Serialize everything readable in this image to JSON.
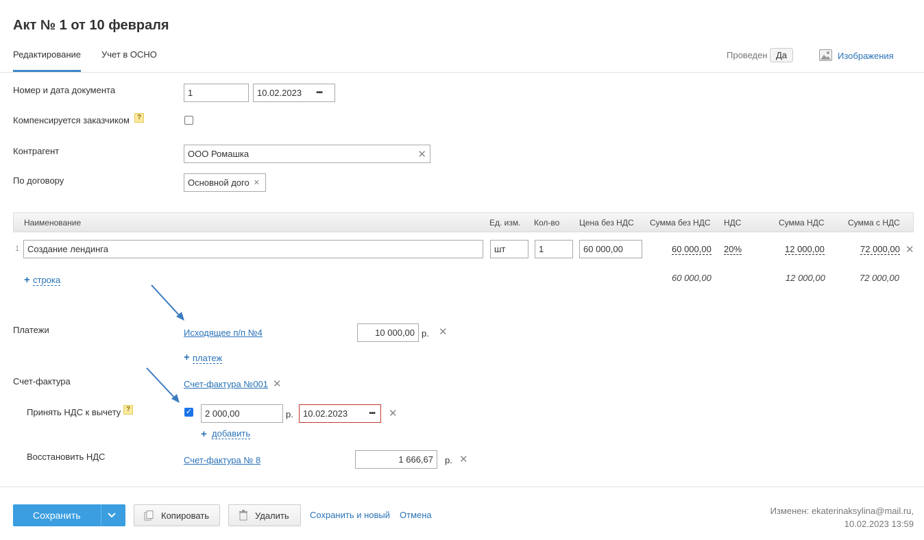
{
  "title": "Акт № 1 от 10 февраля",
  "tabs": [
    {
      "label": "Редактирование",
      "active": true
    },
    {
      "label": "Учет в ОСНО",
      "active": false
    }
  ],
  "header": {
    "posted_label": "Проведен",
    "posted_value": "Да",
    "images_label": "Изображения"
  },
  "form": {
    "doc_label": "Номер и дата документа",
    "doc_number": "1",
    "doc_date": "10.02.2023",
    "compensated_label": "Компенсируется заказчиком",
    "help_glyph": "?",
    "counterparty_label": "Контрагент",
    "counterparty_value": "ООО Ромашка",
    "contract_label": "По договору",
    "contract_value": "Основной дого"
  },
  "table": {
    "headers": [
      "Наименование",
      "Ед. изм.",
      "Кол-во",
      "Цена без НДС",
      "Сумма без НДС",
      "НДС",
      "Сумма НДС",
      "Сумма с НДС"
    ],
    "rows": [
      {
        "index": "1",
        "name": "Создание лендинга",
        "unit": "шт",
        "qty": "1",
        "price": "60 000,00",
        "sum_no_vat": "60 000,00",
        "vat": "20%",
        "vat_sum": "12 000,00",
        "total": "72 000,00"
      }
    ],
    "add_row": "строка",
    "totals": {
      "sum_no_vat": "60 000,00",
      "vat_sum": "12 000,00",
      "total": "72 000,00"
    }
  },
  "payments": {
    "label": "Платежи",
    "doc_link": "Исходящее п/п №4",
    "amount": "10 000,00",
    "currency": "р.",
    "add_label": "платеж"
  },
  "invoice": {
    "label": "Счет-фактура",
    "link": "Счет-фактура №001",
    "accept_vat_label": "Принять НДС к вычету",
    "accept_amount": "2 000,00",
    "currency": "р.",
    "accept_date": "10.02.2023",
    "add_label": "добавить",
    "restore_vat_label": "Восстановить НДС",
    "restore_link": "Счет-фактура № 8",
    "restore_amount": "1 666,67"
  },
  "footer": {
    "save": "Сохранить",
    "copy": "Копировать",
    "delete": "Удалить",
    "save_new": "Сохранить и новый",
    "cancel": "Отмена",
    "modified_line1": "Изменен: ekaterinaksylina@mail.ru,",
    "modified_line2": "10.02.2023 13:59"
  },
  "colors": {
    "accent": "#3a87c8",
    "primary_button": "#3a9ee0",
    "link": "#2a73b8",
    "arrow": "#3b7bbf"
  }
}
